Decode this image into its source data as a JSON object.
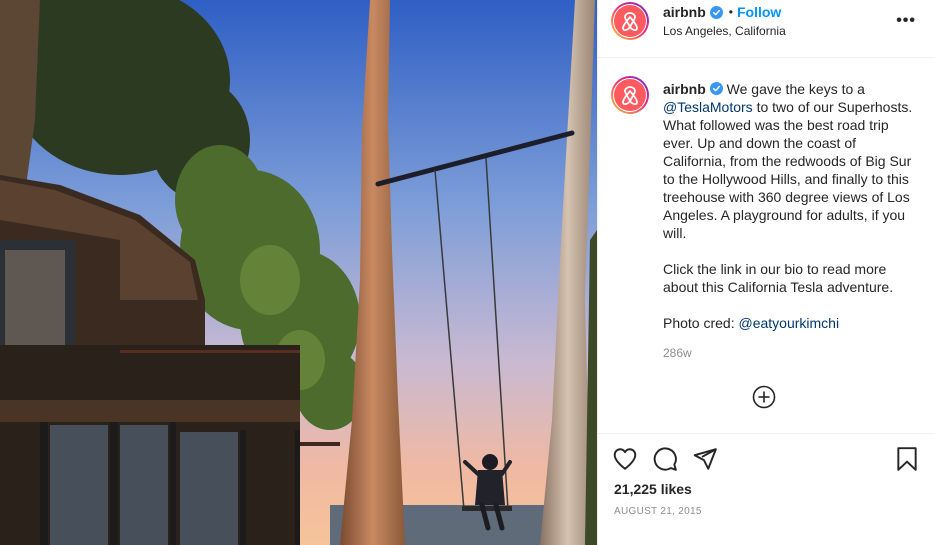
{
  "post": {
    "username": "airbnb",
    "verified": true,
    "follow_label": "Follow",
    "separator": "•",
    "location": "Los Angeles, California",
    "more_label": "•••",
    "caption": {
      "p1_part1": "We gave the keys to a ",
      "p1_mention": "@TeslaMotors",
      "p1_part2": " to two of our Superhosts. What followed was the best road trip ever. Up and down the coast of California, from the redwoods of Big Sur to the Hollywood Hills, and finally to this treehouse with 360 degree views of Los Angeles. A playground for adults, if you will.",
      "p2": "Click the link in our bio to read more about this California Tesla adventure.",
      "p3_part1": "Photo cred: ",
      "p3_mention": "@eatyourkimchi"
    },
    "time_ago": "286w",
    "likes": "21,225 likes",
    "date": "AUGUST 21, 2015"
  },
  "icons": {
    "verified": "verified-badge-icon",
    "more": "more-options-icon",
    "load_more": "plus-circle-icon",
    "like": "heart-icon",
    "comment": "comment-icon",
    "share": "send-icon",
    "save": "bookmark-icon",
    "avatar": "airbnb-logo"
  },
  "colors": {
    "brand": "#ff5a5f",
    "link": "#0095f6",
    "mention": "#00376b",
    "verified": "#3897f0",
    "muted": "#8e8e8e"
  }
}
